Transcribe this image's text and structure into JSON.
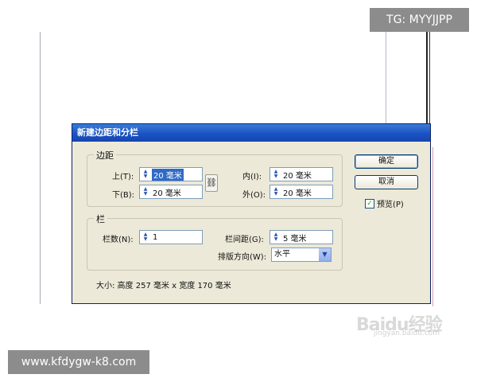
{
  "overlay": {
    "tag": "TG: MYYJJPP",
    "site": "www.kfdygw-k8.com",
    "watermark": "Baidu经验",
    "watermark_sub": "jingyan.baidu.com"
  },
  "dialog": {
    "title": "新建边距和分栏",
    "margins": {
      "group_label": "边距",
      "top": {
        "label": "上(T):",
        "value": "20 毫米"
      },
      "bottom": {
        "label": "下(B):",
        "value": "20 毫米"
      },
      "inside": {
        "label": "内(I):",
        "value": "20 毫米"
      },
      "outside": {
        "label": "外(O):",
        "value": "20 毫米"
      },
      "link_icon": "chain-link-icon"
    },
    "columns": {
      "group_label": "栏",
      "number": {
        "label": "栏数(N):",
        "value": "1"
      },
      "gutter": {
        "label": "栏间距(G):",
        "value": "5 毫米"
      },
      "direction": {
        "label": "排版方向(W):",
        "value": "水平"
      }
    },
    "size_text": "大小: 高度 257 毫米 x 宽度 170 毫米",
    "buttons": {
      "ok": "确定",
      "cancel": "取消"
    },
    "preview": {
      "label": "预览(P)",
      "checked": true
    },
    "colors": {
      "titlebar": "#1b53c4",
      "body": "#ece9d8",
      "selection": "#316ac5"
    }
  }
}
